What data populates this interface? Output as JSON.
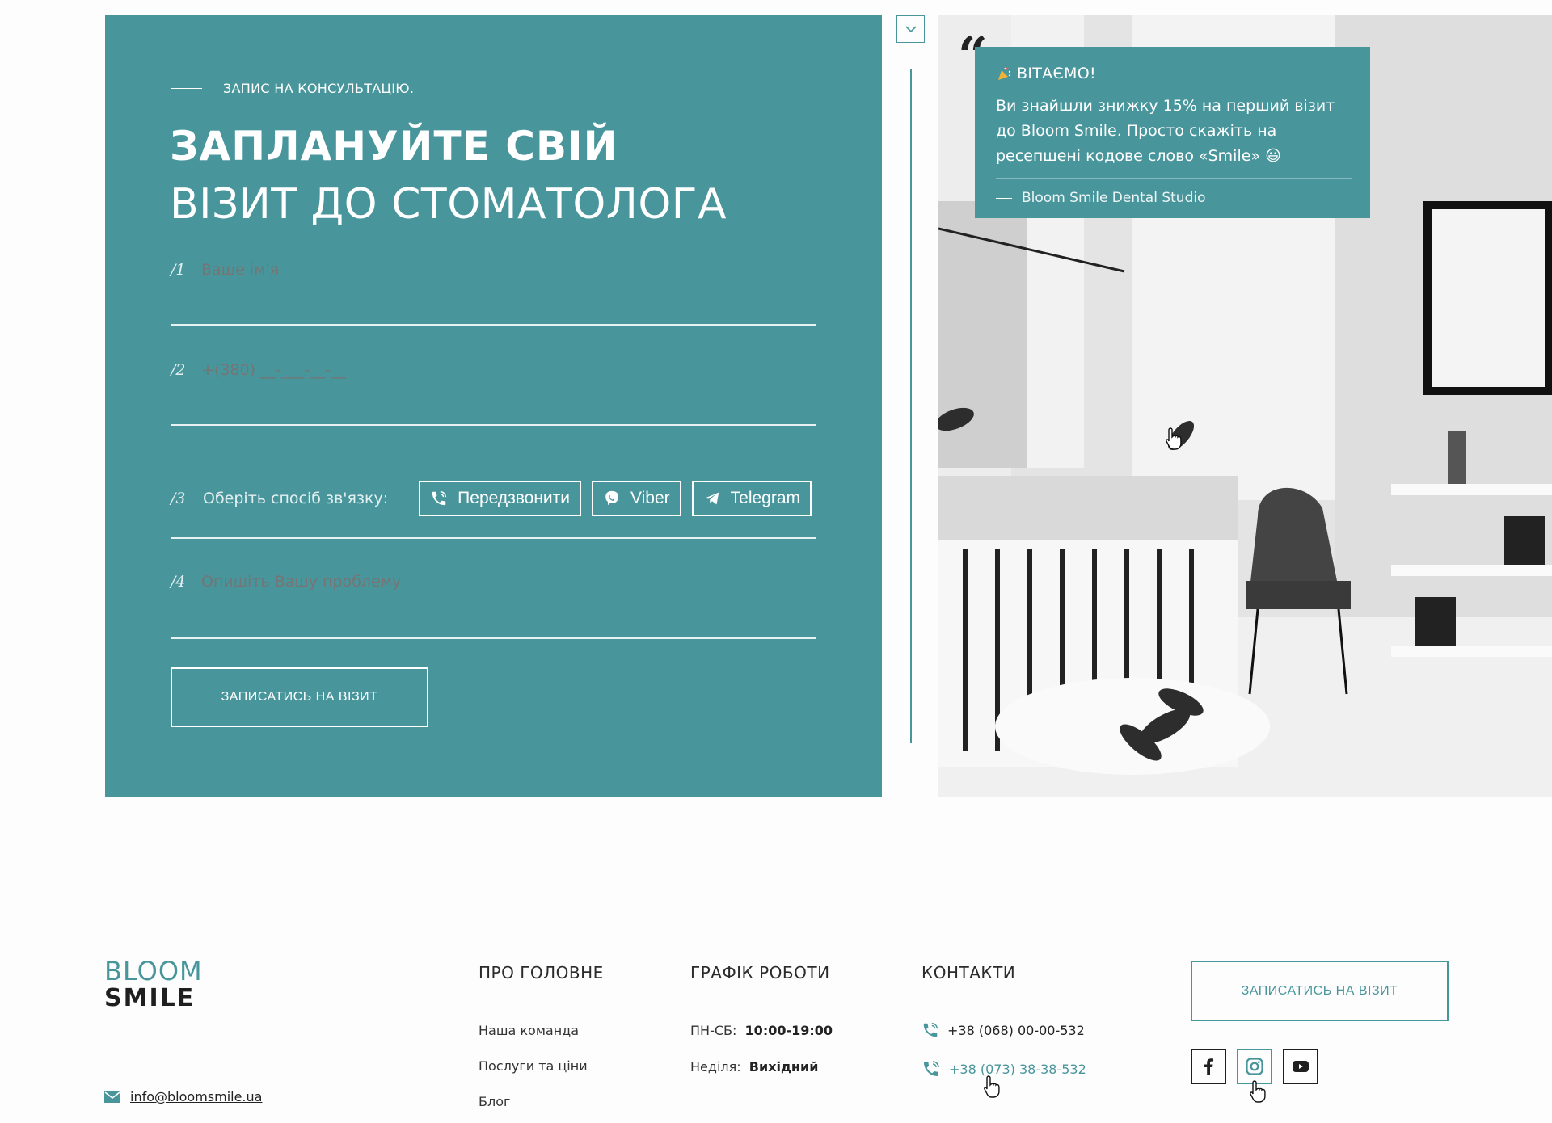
{
  "booking": {
    "eyebrow": "ЗАПИС НА КОНСУЛЬТАЦІЮ.",
    "headline_line1": "ЗАПЛАНУЙТЕ СВІЙ",
    "headline_line2": "ВІЗИТ ДО СТОМАТОЛОГА",
    "fields": [
      {
        "num": "/1",
        "placeholder": "Ваше ім'я"
      },
      {
        "num": "/2",
        "placeholder": "+(380) __-___-__-__"
      },
      {
        "num": "/3",
        "label": "Оберіть спосіб зв'язку:"
      },
      {
        "num": "/4",
        "placeholder": "Опишіть Вашу проблему"
      }
    ],
    "channels": [
      {
        "label": "Передзвонити",
        "icon": "phone-icon"
      },
      {
        "label": "Viber",
        "icon": "viber-icon"
      },
      {
        "label": "Telegram",
        "icon": "telegram-icon"
      }
    ],
    "submit_label": "ЗАПИСАТИСЬ НА ВІЗИТ"
  },
  "promo": {
    "title": "ВІТАЄМО!",
    "title_icon": "party-popper-icon",
    "text": "Ви знайшли знижку 15% на перший візит до Bloom Smile. Просто скажіть на ресепшені кодове слово «Smile» 😃",
    "signature": "Bloom Smile Dental Studio"
  },
  "footer": {
    "logo_top": "BLOOM",
    "logo_bottom": "SMILE",
    "email": "info@bloomsmile.ua",
    "about": {
      "title": "ПРО ГОЛОВНЕ",
      "items": [
        "Наша команда",
        "Послуги та ціни",
        "Блог"
      ]
    },
    "schedule": {
      "title": "ГРАФІК РОБОТИ",
      "rows": [
        {
          "label": "ПН-СБ:",
          "value": "10:00-19:00"
        },
        {
          "label": "Неділя:",
          "value": "Вихідний"
        }
      ]
    },
    "contacts": {
      "title": "КОНТАКТИ",
      "phones": [
        "+38 (068) 00-00-532",
        "+38 (073) 38-38-532"
      ]
    },
    "cta_label": "ЗАПИСАТИСЬ НА ВІЗИТ",
    "socials": [
      "facebook-icon",
      "instagram-icon",
      "youtube-icon"
    ]
  },
  "colors": {
    "brand": "#48969c",
    "text": "#2b2b2b",
    "background": "#fdfdfd"
  }
}
